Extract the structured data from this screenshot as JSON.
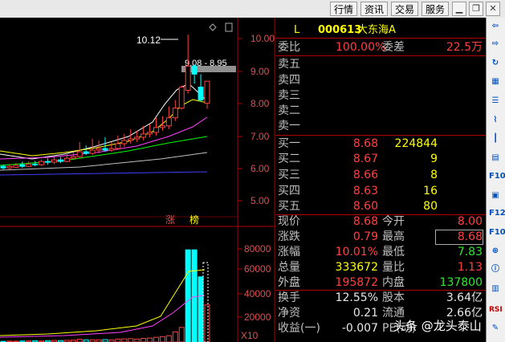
{
  "toolbar": {
    "buttons": [
      "行情",
      "资讯",
      "交易",
      "服务"
    ],
    "minimize_icon": "minimize-icon",
    "restore_icon": "restore-icon",
    "close_icon": "close-icon"
  },
  "kline": {
    "price_axis": [
      "10.00",
      "9.00",
      "8.00",
      "7.00",
      "6.00",
      "5.00"
    ],
    "volume_axis": [
      "80000",
      "60000",
      "40000",
      "20000"
    ],
    "volume_unit": "X10",
    "high_label": "10.12",
    "range_label": "9.08 - 8.95",
    "tags": [
      "涨",
      "榜"
    ]
  },
  "quote": {
    "market_flag": "L",
    "code": "000613",
    "name": "大东海A",
    "weibi_label": "委比",
    "weibi_value": "100.00%",
    "weicha_label": "委差",
    "weicha_value": "22.5万",
    "sell": [
      {
        "label": "卖五",
        "price": "",
        "volume": ""
      },
      {
        "label": "卖四",
        "price": "",
        "volume": ""
      },
      {
        "label": "卖三",
        "price": "",
        "volume": ""
      },
      {
        "label": "卖二",
        "price": "",
        "volume": ""
      },
      {
        "label": "卖一",
        "price": "",
        "volume": ""
      }
    ],
    "buy": [
      {
        "label": "买一",
        "price": "8.68",
        "volume": "224844"
      },
      {
        "label": "买二",
        "price": "8.67",
        "volume": "9"
      },
      {
        "label": "买三",
        "price": "8.66",
        "volume": "8"
      },
      {
        "label": "买四",
        "price": "8.63",
        "volume": "16"
      },
      {
        "label": "买五",
        "price": "8.60",
        "volume": "80"
      }
    ],
    "stats": [
      {
        "l1": "现价",
        "v1": "8.68",
        "l2": "今开",
        "v2": "8.00"
      },
      {
        "l1": "涨跌",
        "v1": "0.79",
        "l2": "最高",
        "v2": "8.68"
      },
      {
        "l1": "涨幅",
        "v1": "10.01%",
        "l2": "最低",
        "v2": "7.83"
      },
      {
        "l1": "总量",
        "v1": "333672",
        "l2": "量比",
        "v2": "1.13"
      },
      {
        "l1": "外盘",
        "v1": "195872",
        "l2": "内盘",
        "v2": "137800"
      }
    ],
    "finance": [
      {
        "l1": "换手",
        "v1": "12.55%",
        "l2": "股本",
        "v2": "3.64亿"
      },
      {
        "l1": "净资",
        "v1": "0.21",
        "l2": "流通",
        "v2": "2.66亿"
      },
      {
        "l1": "收益(一)",
        "v1": "-0.007",
        "l2": "PE(动)",
        "v2": ""
      }
    ]
  },
  "watermark": "头条 @龙头泰山",
  "colors": {
    "up": "#ff4040",
    "down": "#00ffff",
    "ma5": "#ffffff",
    "ma10": "#ffff00",
    "ma20": "#ff40ff",
    "ma60": "#00ff00"
  }
}
